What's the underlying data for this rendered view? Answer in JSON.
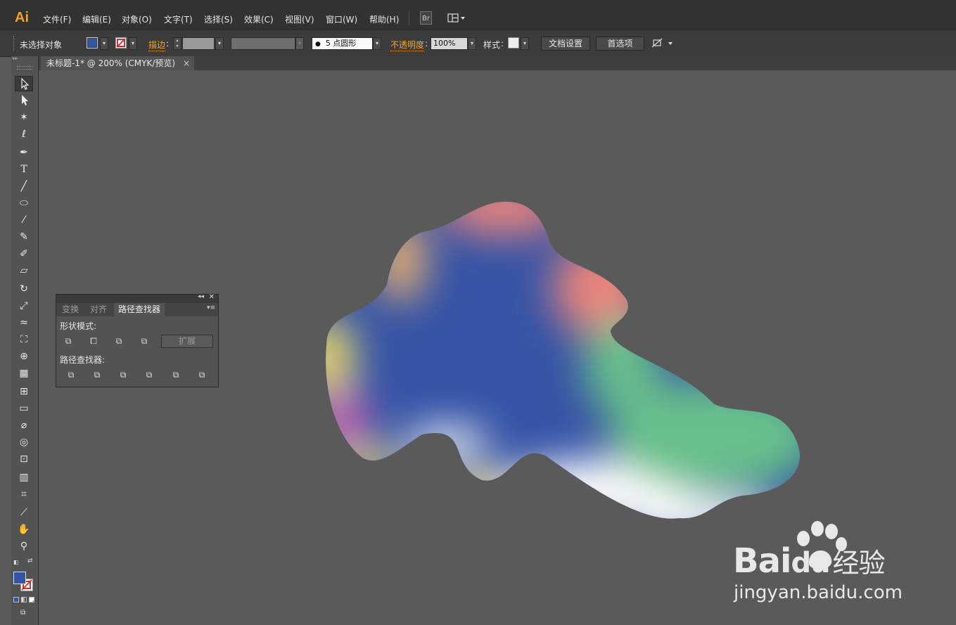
{
  "app": {
    "logo": "Ai"
  },
  "menu": [
    {
      "label": "文件(F)"
    },
    {
      "label": "编辑(E)"
    },
    {
      "label": "对象(O)"
    },
    {
      "label": "文字(T)"
    },
    {
      "label": "选择(S)"
    },
    {
      "label": "效果(C)"
    },
    {
      "label": "视图(V)"
    },
    {
      "label": "窗口(W)"
    },
    {
      "label": "帮助(H)"
    }
  ],
  "menubar_buttons": {
    "bridge": "Br"
  },
  "control": {
    "selection_status": "未选择对象",
    "fill_color": "#3355a8",
    "stroke_label": "描边",
    "brush_size": "5",
    "brush_label": "点圆形",
    "opacity_label": "不透明度",
    "opacity_value": "100%",
    "style_label": "样式",
    "doc_setup": "文档设置",
    "preferences": "首选项"
  },
  "document_tab": {
    "title": "未标题-1* @ 200% (CMYK/预览)",
    "close": "×"
  },
  "panel": {
    "tabs": [
      {
        "label": "变换"
      },
      {
        "label": "对齐"
      },
      {
        "label": "路径查找器"
      }
    ],
    "active_tab": "路径查找器",
    "shape_modes_label": "形状模式:",
    "expand_label": "扩展",
    "pathfinders_label": "路径查找器:"
  },
  "colors": {
    "fill": "#3355a8",
    "accent": "#f7a21b",
    "blob_blue": "#3654a6",
    "blob_pink": "#e8847c",
    "blob_green": "#66c08b",
    "blob_yellow": "#e8d86a",
    "blob_magenta": "#c060b0"
  },
  "watermark": {
    "brand": "Bai",
    "brand2": "du",
    "cn": "经验",
    "url": "jingyan.baidu.com"
  }
}
